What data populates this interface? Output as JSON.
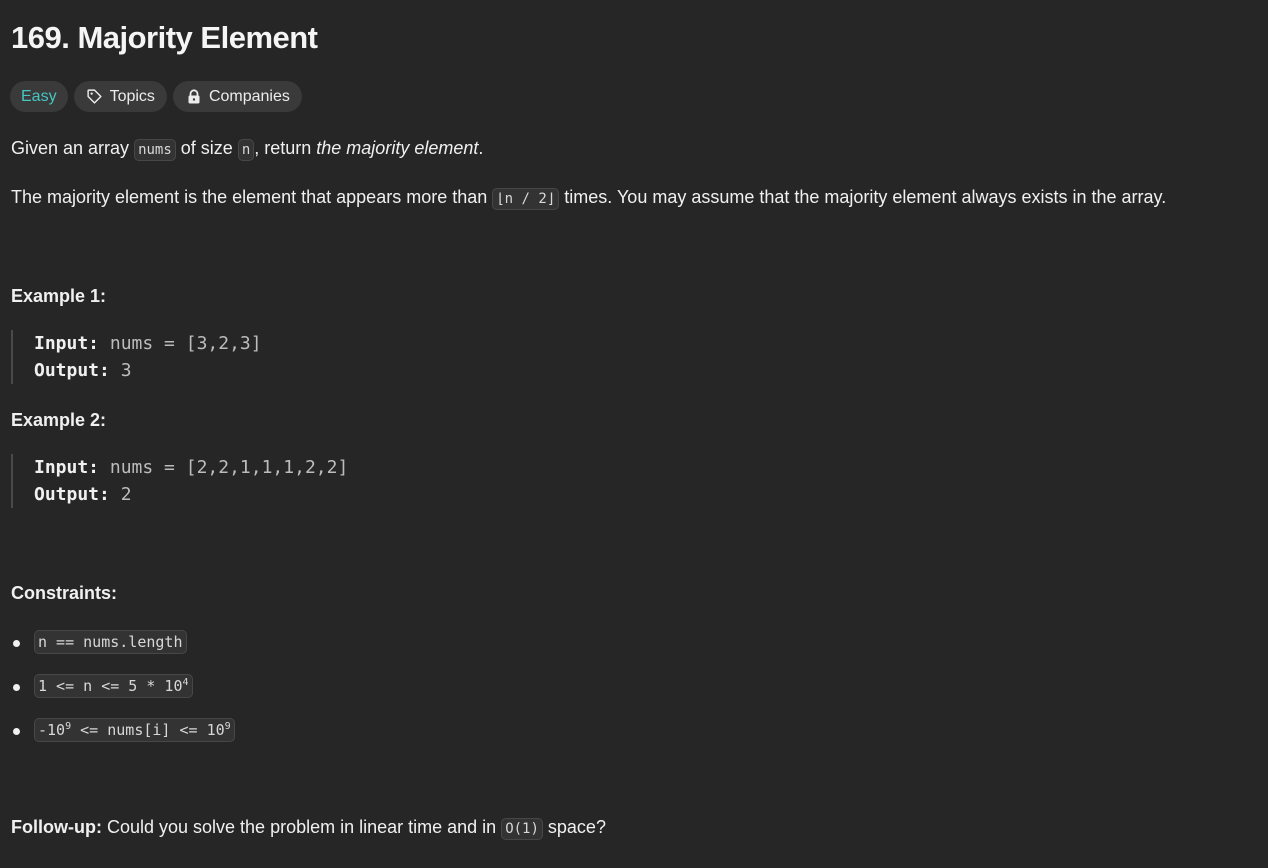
{
  "problem": {
    "title": "169. Majority Element",
    "tags": {
      "difficulty": "Easy",
      "topics": "Topics",
      "companies": "Companies"
    },
    "desc1": {
      "t1": "Given an array ",
      "c1": "nums",
      "t2": " of size ",
      "c2": "n",
      "t3": ", return ",
      "em": "the majority element",
      "t4": "."
    },
    "desc2": {
      "t1": "The majority element is the element that appears more than ",
      "c1": "⌊n / 2⌋",
      "t2": " times. You may assume that the majority element always exists in the array."
    },
    "examples": [
      {
        "heading": "Example 1:",
        "input_label": "Input:",
        "input_value": "nums = [3,2,3]",
        "output_label": "Output:",
        "output_value": "3"
      },
      {
        "heading": "Example 2:",
        "input_label": "Input:",
        "input_value": "nums = [2,2,1,1,1,2,2]",
        "output_label": "Output:",
        "output_value": "2"
      }
    ],
    "constraints": {
      "heading": "Constraints:",
      "c1": "n == nums.length",
      "c2_base": "1 <= n <= 5 * 10",
      "c2_exp": "4",
      "c3_pre": "-10",
      "c3_exp1": "9",
      "c3_mid": " <= nums[i] <= 10",
      "c3_exp2": "9"
    },
    "followup": {
      "label": "Follow-up:",
      "t1": " Could you solve the problem in linear time and in ",
      "c1": "O(1)",
      "t2": " space?"
    }
  }
}
